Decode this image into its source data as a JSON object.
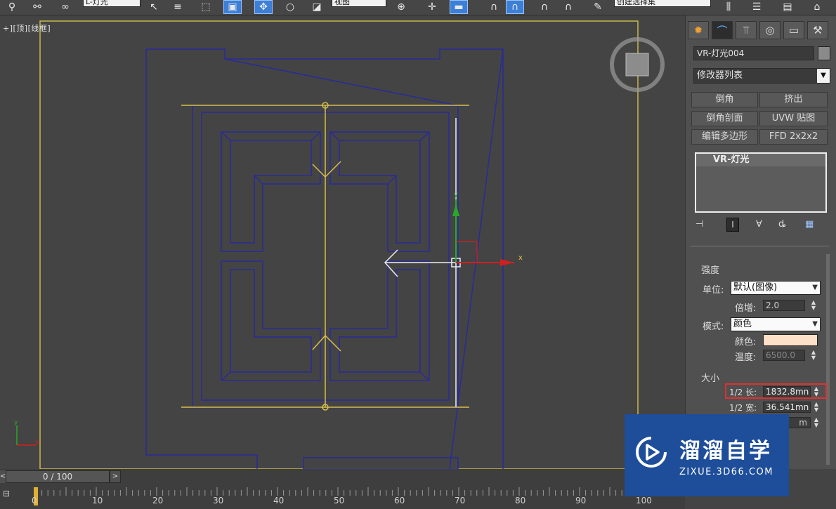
{
  "toolbar": {
    "selection_filter": "L-灯光",
    "reference_coord": "视图",
    "named_selection": "创建选择集"
  },
  "viewport": {
    "label": "+][顶][线框]"
  },
  "panel": {
    "object_name": "VR-灯光004",
    "modifier_list": "修改器列表",
    "buttons": [
      "倒角",
      "挤出",
      "倒角剖面",
      "UVW 贴图",
      "编辑多边形",
      "FFD 2x2x2"
    ],
    "stack_item": "VR-灯光",
    "intensity_group": "强度",
    "units_label": "单位:",
    "units_value": "默认(图像)",
    "multiplier_label": "倍增:",
    "multiplier_value": "2.0",
    "mode_label": "模式:",
    "mode_value": "颜色",
    "color_label": "颜色:",
    "color_value": "#fde0c8",
    "temperature_label": "温度:",
    "temperature_value": "6500.0",
    "size_group": "大小",
    "half_length_label": "1/2 长:",
    "half_length_value": "1832.8mn",
    "half_width_label": "1/2 宽:",
    "half_width_value": "36.541mn",
    "w_size_value": "m"
  },
  "timeline": {
    "frame_display": "0 / 100",
    "prev": "<",
    "next": ">",
    "ticks": [
      "0",
      "10",
      "20",
      "30",
      "40",
      "50",
      "60",
      "70",
      "80",
      "90",
      "100"
    ]
  },
  "watermark": {
    "title": "溜溜自学",
    "url": "ZIXUE.3D66.COM"
  },
  "colors": {
    "highlight_box": "#e03030",
    "selection_yellow": "#d8c04a",
    "wire_blue": "#2a2a9a"
  }
}
